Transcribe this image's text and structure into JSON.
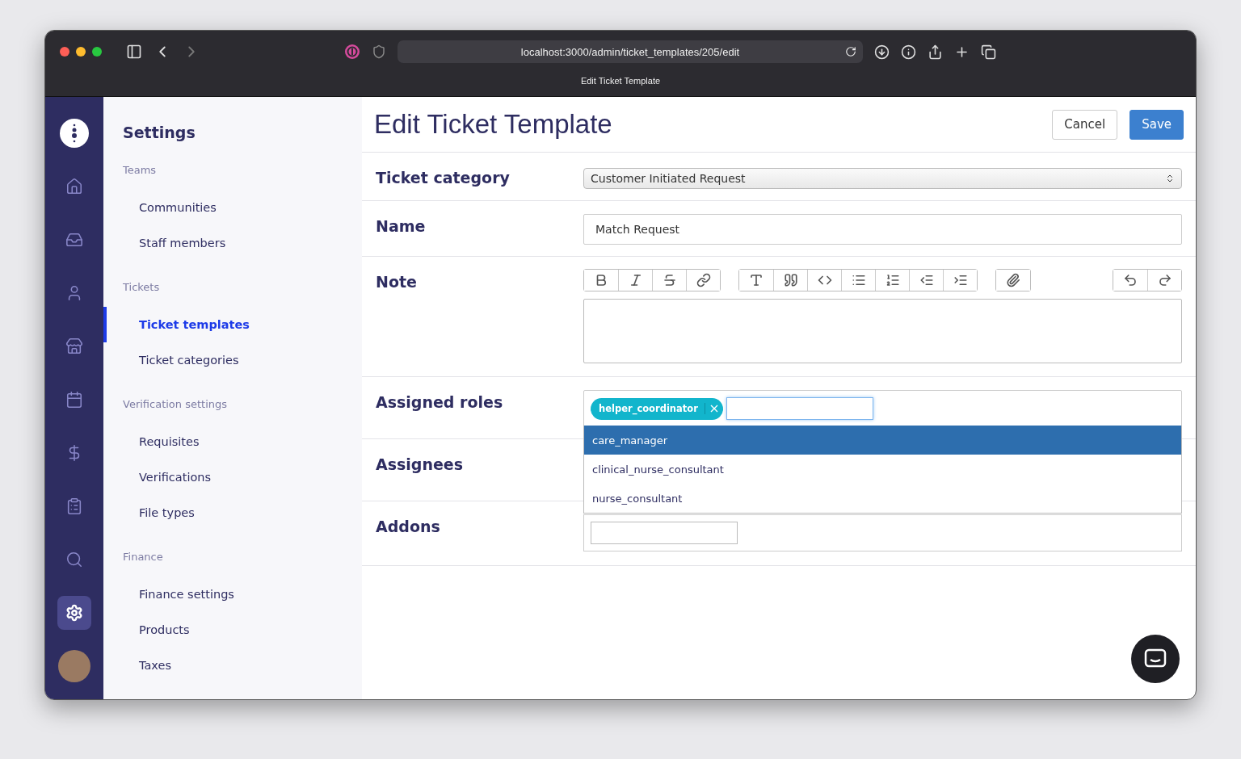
{
  "browser": {
    "url": "localhost:3000/admin/ticket_templates/205/edit",
    "tab_title": "Edit Ticket Template"
  },
  "rail": [
    {
      "kind": "logo",
      "selected": false
    },
    {
      "kind": "home",
      "selected": false
    },
    {
      "kind": "inbox",
      "selected": false
    },
    {
      "kind": "user",
      "selected": false
    },
    {
      "kind": "store",
      "selected": false
    },
    {
      "kind": "calendar",
      "selected": false
    },
    {
      "kind": "dollar",
      "selected": false
    },
    {
      "kind": "clipboard",
      "selected": false
    },
    {
      "kind": "search",
      "selected": false
    },
    {
      "kind": "settings",
      "selected": true
    },
    {
      "kind": "avatar",
      "selected": false
    }
  ],
  "sidebar": {
    "title": "Settings",
    "sections": [
      {
        "heading": "Teams",
        "items": [
          {
            "label": "Communities",
            "selected": false
          },
          {
            "label": "Staff members",
            "selected": false
          }
        ]
      },
      {
        "heading": "Tickets",
        "items": [
          {
            "label": "Ticket templates",
            "selected": true
          },
          {
            "label": "Ticket categories",
            "selected": false
          }
        ]
      },
      {
        "heading": "Verification settings",
        "items": [
          {
            "label": "Requisites",
            "selected": false
          },
          {
            "label": "Verifications",
            "selected": false
          },
          {
            "label": "File types",
            "selected": false
          }
        ]
      },
      {
        "heading": "Finance",
        "items": [
          {
            "label": "Finance settings",
            "selected": false
          },
          {
            "label": "Products",
            "selected": false
          },
          {
            "label": "Taxes",
            "selected": false
          }
        ]
      }
    ]
  },
  "page": {
    "title": "Edit Ticket Template",
    "buttons": [
      {
        "label": "Cancel",
        "kind": "secondary"
      },
      {
        "label": "Save",
        "kind": "primary"
      }
    ]
  },
  "form": [
    {
      "kind": "select",
      "label": "Ticket category",
      "value": "Customer Initiated Request"
    },
    {
      "kind": "text",
      "label": "Name",
      "value": "Match Request"
    },
    {
      "kind": "rich",
      "label": "Note"
    },
    {
      "kind": "tags",
      "label": "Assigned roles",
      "tags": [
        "helper_coordinator"
      ],
      "options": [
        {
          "label": "care_manager",
          "selected": true
        },
        {
          "label": "clinical_nurse_consultant",
          "selected": false
        },
        {
          "label": "nurse_consultant",
          "selected": false
        }
      ]
    },
    {
      "kind": "empty",
      "label": "Assignees"
    },
    {
      "kind": "addons",
      "label": "Addons"
    }
  ]
}
